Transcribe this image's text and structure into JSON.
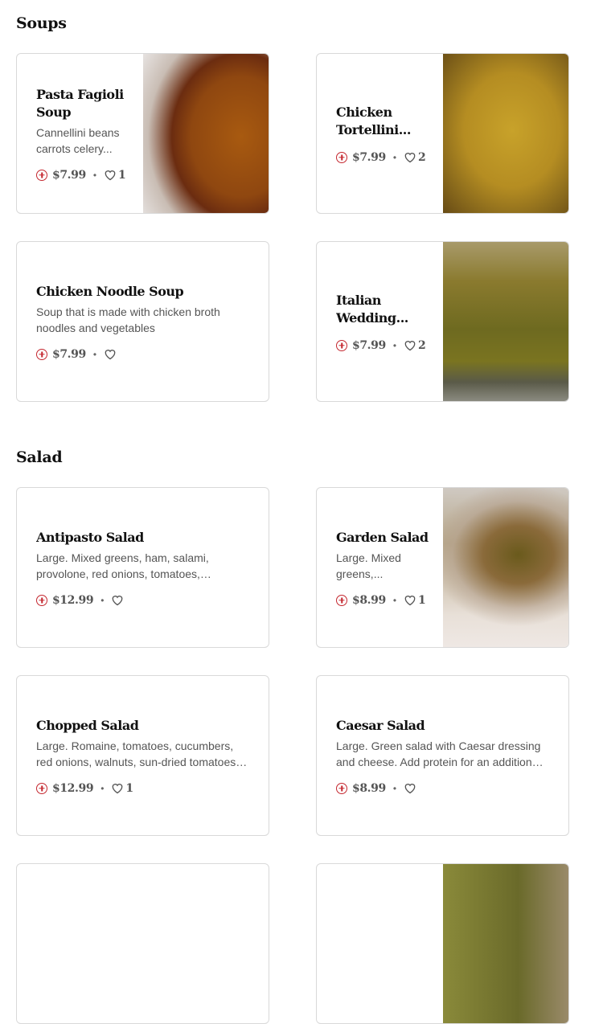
{
  "sections": [
    {
      "title": "Soups"
    },
    {
      "title": "Salad"
    }
  ],
  "items": [
    {
      "name": "Pasta Fagioli Soup",
      "description": "Cannellini beans carrots celery...",
      "price": "$7.99",
      "likes": "1"
    },
    {
      "name": "Chicken Tortellini...",
      "description": "",
      "price": "$7.99",
      "likes": "2"
    },
    {
      "name": "Chicken Noodle Soup",
      "description": "Soup that is made with chicken broth noodles and vegetables",
      "price": "$7.99",
      "likes": ""
    },
    {
      "name": "Italian Wedding...",
      "description": "",
      "price": "$7.99",
      "likes": "2"
    },
    {
      "name": "Antipasto Salad",
      "description": "Large. Mixed greens, ham, salami, provolone, red onions, tomatoes, cucumbers, olives,...",
      "price": "$12.99",
      "likes": ""
    },
    {
      "name": "Garden Salad",
      "description": "Large. Mixed greens,...",
      "price": "$8.99",
      "likes": "1"
    },
    {
      "name": "Chopped Salad",
      "description": "Large. Romaine, tomatoes, cucumbers, red onions, walnuts, sun-dried tomatoes, grilled...",
      "price": "$12.99",
      "likes": "1"
    },
    {
      "name": "Caesar Salad",
      "description": "Large. Green salad with Caesar dressing and cheese. Add protein for an additional charge",
      "price": "$8.99",
      "likes": ""
    }
  ],
  "icons": {
    "add": "add-circle-icon",
    "like": "heart-icon"
  },
  "colors": {
    "accent": "#c4262e",
    "border": "#d9d9d9",
    "text": "#111111",
    "muted": "#555555"
  }
}
